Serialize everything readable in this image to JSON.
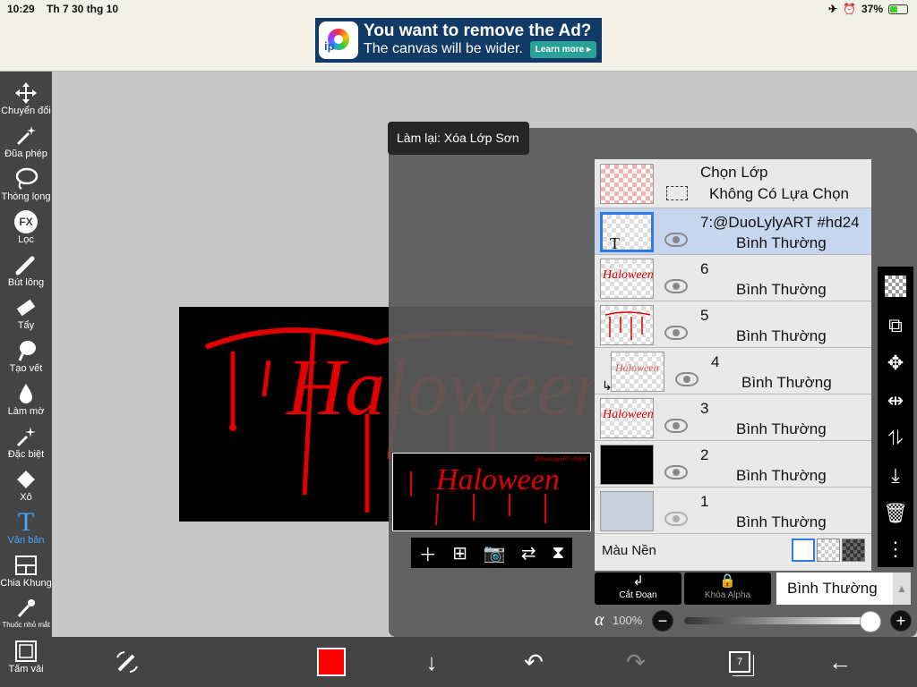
{
  "status": {
    "time": "10:29",
    "date": "Th 7 30 thg 10",
    "battery": "37%"
  },
  "ad": {
    "logo_text": "ip",
    "line1": "You want to remove the Ad?",
    "line2": "The canvas will be wider.",
    "button": "Learn more ▸"
  },
  "tools": [
    {
      "label": "Chuyển đổi",
      "icon": "move-icon"
    },
    {
      "label": "Đũa phép",
      "icon": "magic-wand-icon"
    },
    {
      "label": "Thòng lọng",
      "icon": "lasso-icon"
    },
    {
      "label": "Lọc",
      "icon": "fx-filter-icon"
    },
    {
      "label": "Bút lông",
      "icon": "brush-icon"
    },
    {
      "label": "Tẩy",
      "icon": "eraser-icon"
    },
    {
      "label": "Tạo vết",
      "icon": "smudge-icon"
    },
    {
      "label": "Làm mờ",
      "icon": "blur-drop-icon"
    },
    {
      "label": "Đặc biệt",
      "icon": "sparkle-icon"
    },
    {
      "label": "Xô",
      "icon": "bucket-icon"
    },
    {
      "label": "Văn bản",
      "icon": "text-icon",
      "active": true
    },
    {
      "label": "Chia Khung",
      "icon": "frame-divider-icon"
    },
    {
      "label": "Thuốc nhỏ mắt",
      "icon": "eyedropper-icon"
    },
    {
      "label": "Tấm vải",
      "icon": "canvas-icon"
    }
  ],
  "fx_text": "FX",
  "text_tool_glyph": "T",
  "toast": "Làm lại: Xóa Lớp Sơn",
  "artwork_text": "Haloween",
  "preview_text": "Haloween",
  "preview_caption": "@DuoLylyART #hd24",
  "layers": {
    "header": {
      "title": "Chọn Lớp",
      "subtitle": "Không Có Lựa Chọn"
    },
    "rows": [
      {
        "name": "7:@DuoLylyART #hd24",
        "mode": "Bình Thường",
        "thumb_glyph": "T",
        "selected": true
      },
      {
        "name": "6",
        "mode": "Bình Thường",
        "thumb_text": "Haloween"
      },
      {
        "name": "5",
        "mode": "Bình Thường"
      },
      {
        "name": "4",
        "mode": "Bình Thường",
        "thumb_text": "Haloween"
      },
      {
        "name": "3",
        "mode": "Bình Thường",
        "thumb_text": "Haloween"
      },
      {
        "name": "2",
        "mode": "Bình Thường"
      },
      {
        "name": "1",
        "mode": "Bình Thường"
      }
    ],
    "background_label": "Màu Nền"
  },
  "blend": {
    "clip_label": "Cắt Đoạn",
    "alpha_lock_label": "Khóa Alpha",
    "mode": "Bình Thường"
  },
  "opacity": {
    "symbol": "α",
    "value": "100%"
  },
  "bottom": {
    "layer_count": "7",
    "color": "#ff0000"
  }
}
